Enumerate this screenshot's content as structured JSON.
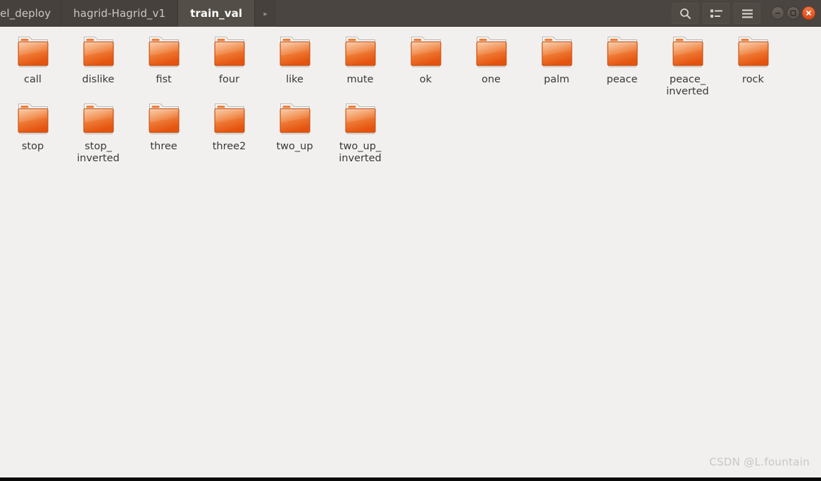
{
  "window": {
    "tabs": [
      {
        "label": "el_deploy",
        "active": false,
        "truncated": true
      },
      {
        "label": "hagrid-Hagrid_v1",
        "active": false,
        "truncated": false
      },
      {
        "label": "train_val",
        "active": true,
        "truncated": false
      }
    ],
    "next_tab_arrow": "▸",
    "toolbar": [
      {
        "name": "search-icon",
        "glyph": "search"
      },
      {
        "name": "view-list-icon",
        "glyph": "list"
      },
      {
        "name": "menu-icon",
        "glyph": "hamburger"
      }
    ],
    "controls": {
      "minimize_label": "–",
      "maximize_label": "□",
      "close_label": "×"
    },
    "colors": {
      "titlebar_bg": "#4a4540",
      "tab_active_bg": "#534e48",
      "content_bg": "#f1f0ee",
      "folder_orange": "#e8601c",
      "close_button": "#dd4814",
      "label_text": "#383838"
    }
  },
  "files": [
    {
      "name": "call",
      "display": "call",
      "type": "folder"
    },
    {
      "name": "dislike",
      "display": "dislike",
      "type": "folder"
    },
    {
      "name": "fist",
      "display": "fist",
      "type": "folder"
    },
    {
      "name": "four",
      "display": "four",
      "type": "folder"
    },
    {
      "name": "like",
      "display": "like",
      "type": "folder"
    },
    {
      "name": "mute",
      "display": "mute",
      "type": "folder"
    },
    {
      "name": "ok",
      "display": "ok",
      "type": "folder"
    },
    {
      "name": "one",
      "display": "one",
      "type": "folder"
    },
    {
      "name": "palm",
      "display": "palm",
      "type": "folder"
    },
    {
      "name": "peace",
      "display": "peace",
      "type": "folder"
    },
    {
      "name": "peace_inverted",
      "display": "peace_\ninverted",
      "type": "folder"
    },
    {
      "name": "rock",
      "display": "rock",
      "type": "folder"
    },
    {
      "name": "stop",
      "display": "stop",
      "type": "folder"
    },
    {
      "name": "stop_inverted",
      "display": "stop_\ninverted",
      "type": "folder"
    },
    {
      "name": "three",
      "display": "three",
      "type": "folder"
    },
    {
      "name": "three2",
      "display": "three2",
      "type": "folder"
    },
    {
      "name": "two_up",
      "display": "two_up",
      "type": "folder"
    },
    {
      "name": "two_up_inverted",
      "display": "two_up_\ninverted",
      "type": "folder"
    }
  ],
  "watermark": {
    "text": "CSDN @L.fountain"
  }
}
